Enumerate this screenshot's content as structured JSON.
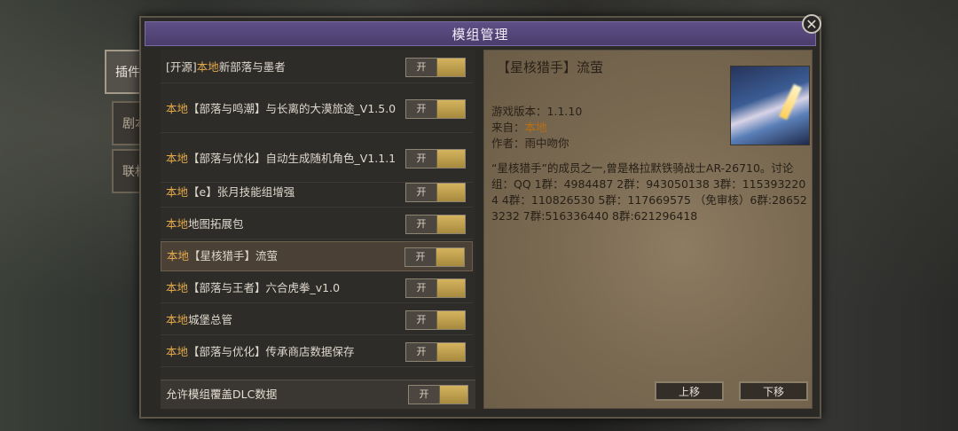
{
  "dialog": {
    "title": "模组管理",
    "close_glyph": "✕"
  },
  "side_tabs": [
    {
      "label": "插件",
      "active": true
    },
    {
      "label": "剧本",
      "active": false
    },
    {
      "label": "联机",
      "active": false
    }
  ],
  "mods": [
    {
      "prefix": "[开源]",
      "source": "本地",
      "name": "新部落与墨者",
      "toggle": "开",
      "enabled": true
    },
    {
      "prefix": "",
      "source": "本地",
      "name": "【部落与鸣潮】与长离的大漠旅途_V1.5.0",
      "toggle": "开",
      "enabled": true
    },
    {
      "prefix": "",
      "source": "本地",
      "name": "【部落与优化】自动生成随机角色_V1.1.1",
      "toggle": "开",
      "enabled": true
    },
    {
      "prefix": "",
      "source": "本地",
      "name": "【e】张月技能组增强",
      "toggle": "开",
      "enabled": true
    },
    {
      "prefix": "",
      "source": "本地",
      "name": "地图拓展包",
      "toggle": "开",
      "enabled": true
    },
    {
      "prefix": "",
      "source": "本地",
      "name": "【星核猎手】流萤",
      "toggle": "开",
      "enabled": true,
      "selected": true
    },
    {
      "prefix": "",
      "source": "本地",
      "name": "【部落与王者】六合虎拳_v1.0",
      "toggle": "开",
      "enabled": true
    },
    {
      "prefix": "",
      "source": "本地",
      "name": "城堡总管",
      "toggle": "开",
      "enabled": true
    },
    {
      "prefix": "",
      "source": "本地",
      "name": "【部落与优化】传承商店数据保存",
      "toggle": "开",
      "enabled": true
    }
  ],
  "dlc_option": {
    "label": "允许模组覆盖DLC数据",
    "toggle": "开",
    "enabled": true
  },
  "detail": {
    "title": "【星核猎手】流萤",
    "version_label": "游戏版本：",
    "version": "1.1.10",
    "from_label": "来自：",
    "from": "本地",
    "author_label": "作者：",
    "author": "雨中吻你",
    "description": "“星核猎手”的成员之一,曾是格拉默铁骑战士AR-26710。讨论组：QQ 1群：4984487 2群：943050138 3群：1153932204 4群：110826530 5群：117669575 （免审核）6群:286523232 7群:516336440 8群:621296418",
    "move_up": "上移",
    "move_down": "下移"
  },
  "colors": {
    "accent_source": "#e3a94a",
    "title_bar": "#5e4f85",
    "toggle_on": "#c9a74f"
  }
}
